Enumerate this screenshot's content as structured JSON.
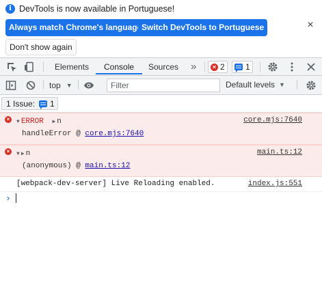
{
  "infobar": {
    "message": "DevTools is now available in Portuguese!",
    "info_icon": "info-icon",
    "buttons": {
      "always_match": "Always match Chrome's language",
      "switch_language": "Switch DevTools to Portuguese",
      "dont_show": "Don't show again"
    },
    "close_glyph": "×"
  },
  "tabs": [
    {
      "label": "Elements",
      "active": false
    },
    {
      "label": "Console",
      "active": true
    },
    {
      "label": "Sources",
      "active": false
    }
  ],
  "tabbar": {
    "more_tabs_glyph": "»",
    "error_count": "2",
    "message_count": "1"
  },
  "console_toolbar": {
    "context": "top",
    "filter_placeholder": "Filter",
    "levels": "Default levels"
  },
  "issues": {
    "label": "1 Issue:",
    "count": "1"
  },
  "messages": [
    {
      "type": "error",
      "head_prefix": "ERROR",
      "head_text": "n",
      "source": "core.mjs:7640",
      "detail_fn": "handleError @ ",
      "detail_link": "core.mjs:7640"
    },
    {
      "type": "error",
      "head_text": "n",
      "source": "main.ts:12",
      "detail_fn": "(anonymous) @ ",
      "detail_link": "main.ts:12"
    },
    {
      "type": "log",
      "text": "[webpack-dev-server] Live Reloading enabled.",
      "source": "index.js:551"
    }
  ],
  "prompt_glyph": "›",
  "colors": {
    "accent": "#1a73e8",
    "error": "#d93025",
    "error_bg": "#fcebeb",
    "toolbar_bg": "#f1f3f4"
  }
}
